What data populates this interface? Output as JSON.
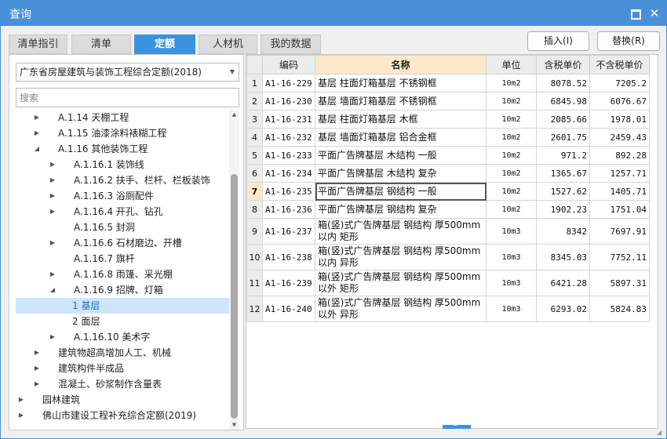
{
  "window": {
    "title": "查询"
  },
  "tabs": [
    "清单指引",
    "清单",
    "定额",
    "人材机",
    "我的数据"
  ],
  "active_tab": 2,
  "buttons": {
    "insert": "插入(I)",
    "replace": "替换(R)"
  },
  "quota_select": {
    "value": "广东省房屋建筑与装饰工程综合定额(2018)"
  },
  "search": {
    "placeholder": "搜索"
  },
  "tree": [
    {
      "label": "A.1.14 天棚工程",
      "level": 1,
      "toggle": "right"
    },
    {
      "label": "A.1.15 油漆涂料裱糊工程",
      "level": 1,
      "toggle": "right"
    },
    {
      "label": "A.1.16 其他装饰工程",
      "level": 1,
      "toggle": "down"
    },
    {
      "label": "A.1.16.1 装饰线",
      "level": 2,
      "toggle": "right"
    },
    {
      "label": "A.1.16.2 扶手、栏杆、栏板装饰",
      "level": 2,
      "toggle": "right"
    },
    {
      "label": "A.1.16.3 浴厕配件",
      "level": 2,
      "toggle": "right"
    },
    {
      "label": "A.1.16.4 开孔、钻孔",
      "level": 2,
      "toggle": "right"
    },
    {
      "label": "A.1.16.5 封洞",
      "level": 2,
      "toggle": ""
    },
    {
      "label": "A.1.16.6 石材磨边、开槽",
      "level": 2,
      "toggle": "right"
    },
    {
      "label": "A.1.16.7 旗杆",
      "level": 2,
      "toggle": ""
    },
    {
      "label": "A.1.16.8 雨篷、采光棚",
      "level": 2,
      "toggle": "right"
    },
    {
      "label": "A.1.16.9 招牌、灯箱",
      "level": 2,
      "toggle": "down"
    },
    {
      "label": "1 基层",
      "level": 3,
      "toggle": "",
      "selected": true
    },
    {
      "label": "2 面层",
      "level": 3,
      "toggle": ""
    },
    {
      "label": "A.1.16.10 美术字",
      "level": 2,
      "toggle": "right"
    },
    {
      "label": "建筑物超高增加人工、机械",
      "level": 1,
      "toggle": "right"
    },
    {
      "label": "建筑构件半成品",
      "level": 1,
      "toggle": "right"
    },
    {
      "label": "混凝土、砂浆制作含量表",
      "level": 1,
      "toggle": "right"
    },
    {
      "label": "园林建筑",
      "level": 0,
      "toggle": "right"
    },
    {
      "label": "佛山市建设工程补充综合定额(2019)",
      "level": 0,
      "toggle": "right"
    }
  ],
  "grid": {
    "columns": [
      "",
      "编码",
      "名称",
      "单位",
      "含税单价",
      "不含税单价"
    ],
    "current_row": 7,
    "rows": [
      {
        "idx": "1",
        "code": "A1-16-229",
        "name": "基层 柱面灯箱基层 不锈钢框",
        "unit": "10m2",
        "tax": "8078.52",
        "notax": "7205.2"
      },
      {
        "idx": "2",
        "code": "A1-16-230",
        "name": "基层 墙面灯箱基层 不锈钢框",
        "unit": "10m2",
        "tax": "6845.98",
        "notax": "6076.67"
      },
      {
        "idx": "3",
        "code": "A1-16-231",
        "name": "基层 柱面灯箱基层 木框",
        "unit": "10m2",
        "tax": "2085.66",
        "notax": "1978.01"
      },
      {
        "idx": "4",
        "code": "A1-16-232",
        "name": "基层 墙面灯箱基层 铝合金框",
        "unit": "10m2",
        "tax": "2601.75",
        "notax": "2459.43"
      },
      {
        "idx": "5",
        "code": "A1-16-233",
        "name": "平面广告牌基层 木结构 一般",
        "unit": "10m2",
        "tax": "971.2",
        "notax": "892.28"
      },
      {
        "idx": "6",
        "code": "A1-16-234",
        "name": "平面广告牌基层 木结构 复杂",
        "unit": "10m2",
        "tax": "1365.67",
        "notax": "1257.71"
      },
      {
        "idx": "7",
        "code": "A1-16-235",
        "name": "平面广告牌基层 钢结构 一般",
        "unit": "10m2",
        "tax": "1527.62",
        "notax": "1405.71"
      },
      {
        "idx": "8",
        "code": "A1-16-236",
        "name": "平面广告牌基层 钢结构 复杂",
        "unit": "10m2",
        "tax": "1902.23",
        "notax": "1751.04"
      },
      {
        "idx": "9",
        "code": "A1-16-237",
        "name": "箱(竖)式广告牌基层 钢结构 厚500mm以内 矩形",
        "unit": "10m3",
        "tax": "8342",
        "notax": "7697.91"
      },
      {
        "idx": "10",
        "code": "A1-16-238",
        "name": "箱(竖)式广告牌基层 钢结构 厚500mm以内 异形",
        "unit": "10m3",
        "tax": "8345.03",
        "notax": "7752.11"
      },
      {
        "idx": "11",
        "code": "A1-16-239",
        "name": "箱(竖)式广告牌基层 钢结构 厚500mm以外 矩形",
        "unit": "10m3",
        "tax": "6421.28",
        "notax": "5897.31"
      },
      {
        "idx": "12",
        "code": "A1-16-240",
        "name": "箱(竖)式广告牌基层 钢结构 厚500mm以外 异形",
        "unit": "10m3",
        "tax": "6293.02",
        "notax": "5824.83"
      }
    ]
  },
  "colors": {
    "accent": "#3a93e0",
    "titlebar": "#4a90d9",
    "selected_row": "#cde6fb",
    "header_highlight": "#fde9c9"
  }
}
